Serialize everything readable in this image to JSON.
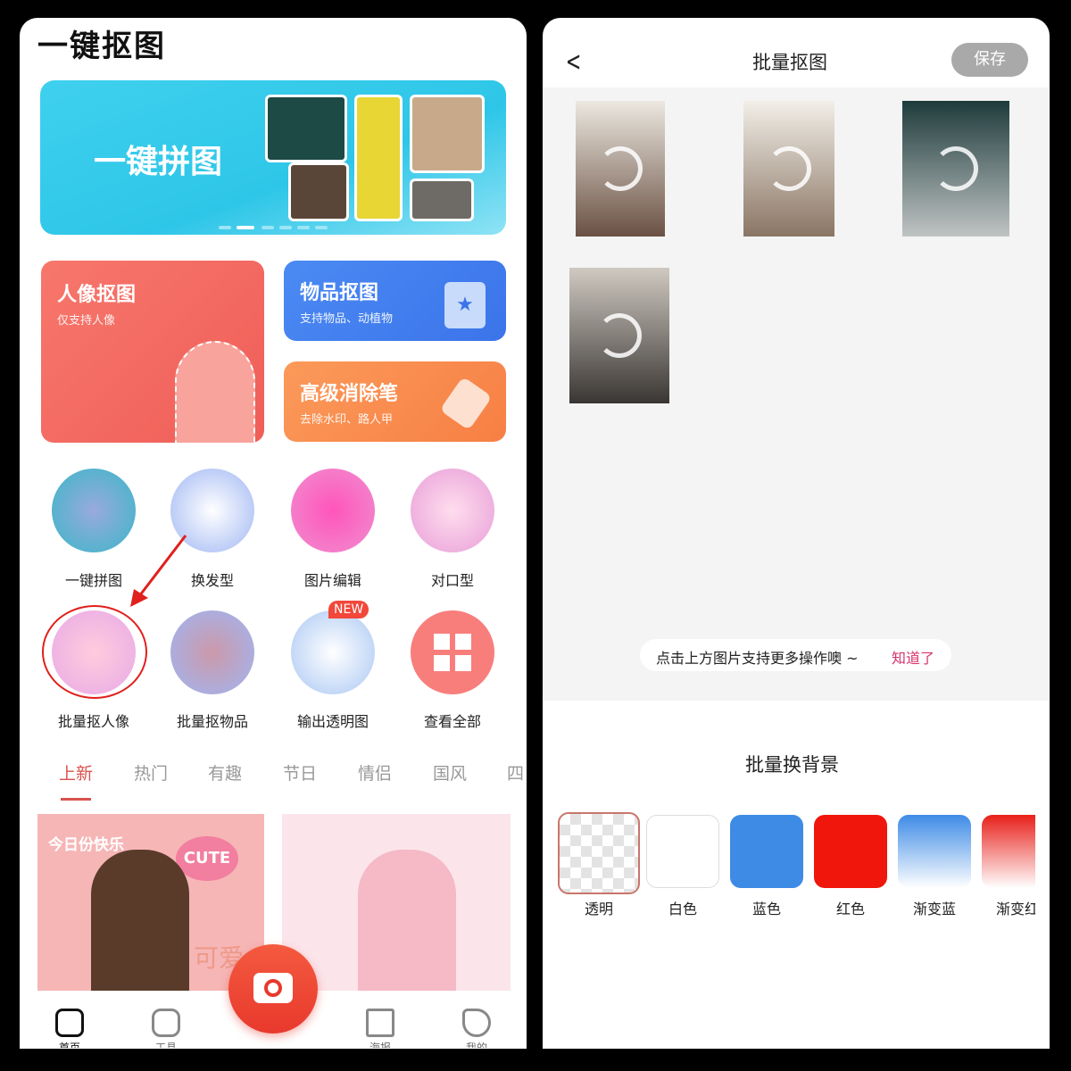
{
  "left": {
    "app_title": "一键抠图",
    "banner": {
      "title": "一键拼图",
      "active_dot": 2,
      "dot_count": 6
    },
    "cards": [
      {
        "title": "人像抠图",
        "subtitle": "仅支持人像",
        "color": "#f4675f"
      },
      {
        "title": "物品抠图",
        "subtitle": "支持物品、动植物",
        "color": "#3d7bef"
      },
      {
        "title": "高级消除笔",
        "subtitle": "去除水印、路人甲",
        "color": "#f98a4e"
      }
    ],
    "tools": [
      {
        "label": "一键拼图"
      },
      {
        "label": "换发型"
      },
      {
        "label": "图片编辑"
      },
      {
        "label": "对口型"
      },
      {
        "label": "批量抠人像"
      },
      {
        "label": "批量抠物品"
      },
      {
        "label": "输出透明图",
        "badge": "NEW"
      },
      {
        "label": "查看全部"
      }
    ],
    "tabs": [
      "上新",
      "热门",
      "有趣",
      "节日",
      "情侣",
      "国风",
      "四"
    ],
    "active_tab": "上新",
    "template_cards": [
      {
        "title": "今日份快乐",
        "sticker": "CUTE",
        "caption": "可爱"
      },
      {}
    ],
    "bottom_nav": [
      "首页",
      "工具",
      "海报",
      "我的"
    ],
    "accent": "#e2474a"
  },
  "right": {
    "header": {
      "title": "批量抠图",
      "save": "保存"
    },
    "tip": {
      "text": "点击上方图片支持更多操作噢 ~",
      "action": "知道了"
    },
    "section_title": "批量换背景",
    "backgrounds": [
      {
        "label": "透明",
        "selected": true
      },
      {
        "label": "白色",
        "color": "#ffffff"
      },
      {
        "label": "蓝色",
        "color": "#3e8be6"
      },
      {
        "label": "红色",
        "color": "#f0160c"
      },
      {
        "label": "渐变蓝",
        "color": "#3e8be6"
      },
      {
        "label": "渐变红",
        "color": "#e8201a"
      }
    ]
  }
}
